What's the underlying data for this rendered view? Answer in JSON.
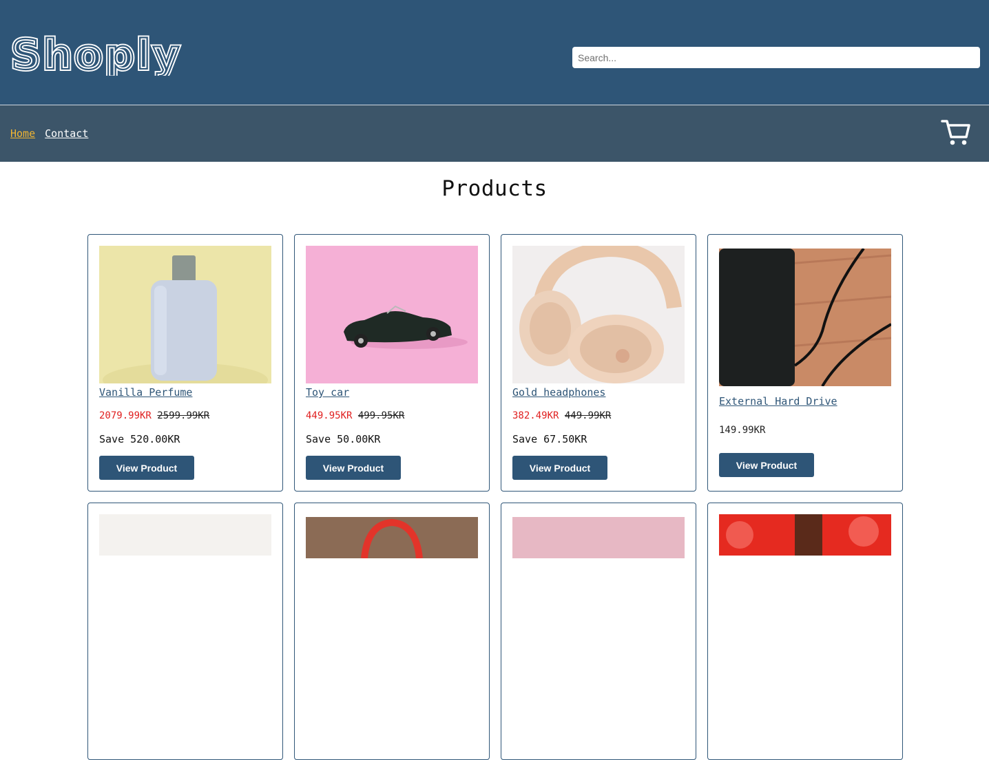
{
  "header": {
    "logo_text": "Shoply",
    "search_placeholder": "Search...",
    "search_value": ""
  },
  "nav": {
    "links": [
      {
        "label": "Home",
        "active": true
      },
      {
        "label": "Contact",
        "active": false
      }
    ],
    "cart_icon": "cart-icon"
  },
  "main": {
    "title": "Products",
    "products": [
      {
        "name": "Vanilla Perfume",
        "sale_price": "2079.99KR",
        "original_price": "2599.99KR",
        "save": "Save 520.00KR",
        "button": "View Product",
        "image": "perfume-bottle"
      },
      {
        "name": "Toy car",
        "sale_price": "449.95KR",
        "original_price": "499.95KR",
        "save": "Save 50.00KR",
        "button": "View Product",
        "image": "toy-car"
      },
      {
        "name": "Gold headphones",
        "sale_price": "382.49KR",
        "original_price": "449.99KR",
        "save": "Save 67.50KR",
        "button": "View Product",
        "image": "headphones"
      },
      {
        "name": "External Hard Drive",
        "price": "149.99KR",
        "button": "View Product",
        "image": "hard-drive"
      }
    ],
    "second_row_images": [
      "white-product",
      "red-headphones",
      "pink-product",
      "red-bottle"
    ]
  },
  "colors": {
    "header_bg": "#2e5577",
    "nav_bg": "#3c5569",
    "active_link": "#f2b632",
    "sale_price": "#e02020",
    "button_bg": "#2e5577"
  }
}
